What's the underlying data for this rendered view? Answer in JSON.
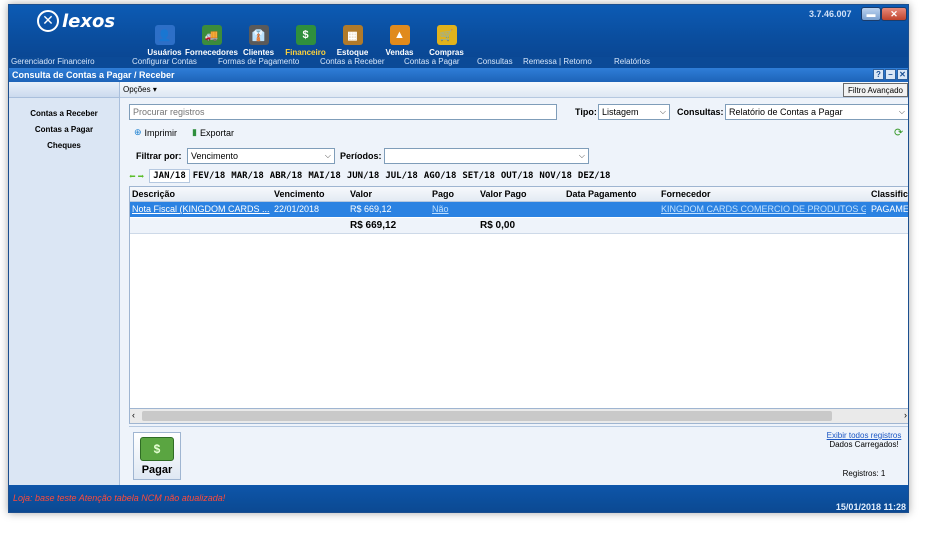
{
  "app": {
    "logo_text": "lexos",
    "version": "3.7.46.007",
    "window_min": "▬",
    "window_close": "✕"
  },
  "modules": [
    {
      "label": "Usuários",
      "icon": "users-icon",
      "color": "#2d6fc7",
      "glyph": "👤"
    },
    {
      "label": "Fornecedores",
      "icon": "suppliers-icon",
      "color": "#3c8c3c",
      "glyph": "🚚"
    },
    {
      "label": "Clientes",
      "icon": "clients-icon",
      "color": "#5a5a5a",
      "glyph": "👔"
    },
    {
      "label": "Financeiro",
      "icon": "finance-icon",
      "color": "#2f8f3d",
      "glyph": "$",
      "active": true
    },
    {
      "label": "Estoque",
      "icon": "stock-icon",
      "color": "#b07a2a",
      "glyph": "▦"
    },
    {
      "label": "Vendas",
      "icon": "sales-icon",
      "color": "#e08a1c",
      "glyph": "▲"
    },
    {
      "label": "Compras",
      "icon": "purchases-icon",
      "color": "#e0b21c",
      "glyph": "🛒"
    }
  ],
  "subnav": {
    "title": "Gerenciador Financeiro",
    "items": [
      "Configurar Contas",
      "Formas de Pagamento",
      "Contas a Receber",
      "Contas a Pagar",
      "Consultas",
      "Remessa | Retorno",
      "Relatórios"
    ]
  },
  "window": {
    "title": "Consulta de Contas a Pagar / Receber",
    "btn_help": "?",
    "btn_min": "–",
    "btn_close": "✕"
  },
  "left_nav": [
    "Contas a Receber",
    "Contas a Pagar",
    "Cheques"
  ],
  "toolbar": {
    "options_label": "Opções",
    "advanced_filter": "Filtro Avançado",
    "search_placeholder": "Procurar registros",
    "tipo_label": "Tipo:",
    "tipo_value": "Listagem",
    "consultas_label": "Consultas:",
    "consultas_value": "Relatório de Contas a Pagar",
    "print_label": "Imprimir",
    "export_label": "Exportar",
    "filter_by_label": "Filtrar por:",
    "filter_by_value": "Vencimento",
    "periods_label": "Períodos:",
    "periods_value": ""
  },
  "months": [
    "JAN/18",
    "FEV/18",
    "MAR/18",
    "ABR/18",
    "MAI/18",
    "JUN/18",
    "JUL/18",
    "AGO/18",
    "SET/18",
    "OUT/18",
    "NOV/18",
    "DEZ/18"
  ],
  "selected_month": "JAN/18",
  "table": {
    "columns": [
      "Descrição",
      "Vencimento",
      "Valor",
      "Pago",
      "Valor Pago",
      "Data Pagamento",
      "Fornecedor",
      "Classificaç"
    ],
    "rows": [
      [
        "Nota Fiscal (KINGDOM CARDS ...",
        "22/01/2018",
        "R$ 669,12",
        "Não",
        "",
        "",
        "KINGDOM CARDS COMERCIO DE PRODUTOS GR...",
        "PAGAMENTO"
      ]
    ],
    "totals": {
      "valor": "R$ 669,12",
      "valor_pago": "R$ 0,00"
    }
  },
  "bottom": {
    "pay_button": "Pagar",
    "show_all_link": "Exibir todos registros",
    "loaded_status": "Dados Carregados!",
    "records": "Registros: 1"
  },
  "statusbar": {
    "message": "Loja: base teste   Atenção tabela NCM não atualizada!",
    "datetime": "15/01/2018   11:28"
  },
  "colors": {
    "header_blue": "#0a4e9f",
    "selection_blue": "#2b82e2",
    "warning_red": "#ff4a3a",
    "active_module_yellow": "#ffd23a"
  }
}
